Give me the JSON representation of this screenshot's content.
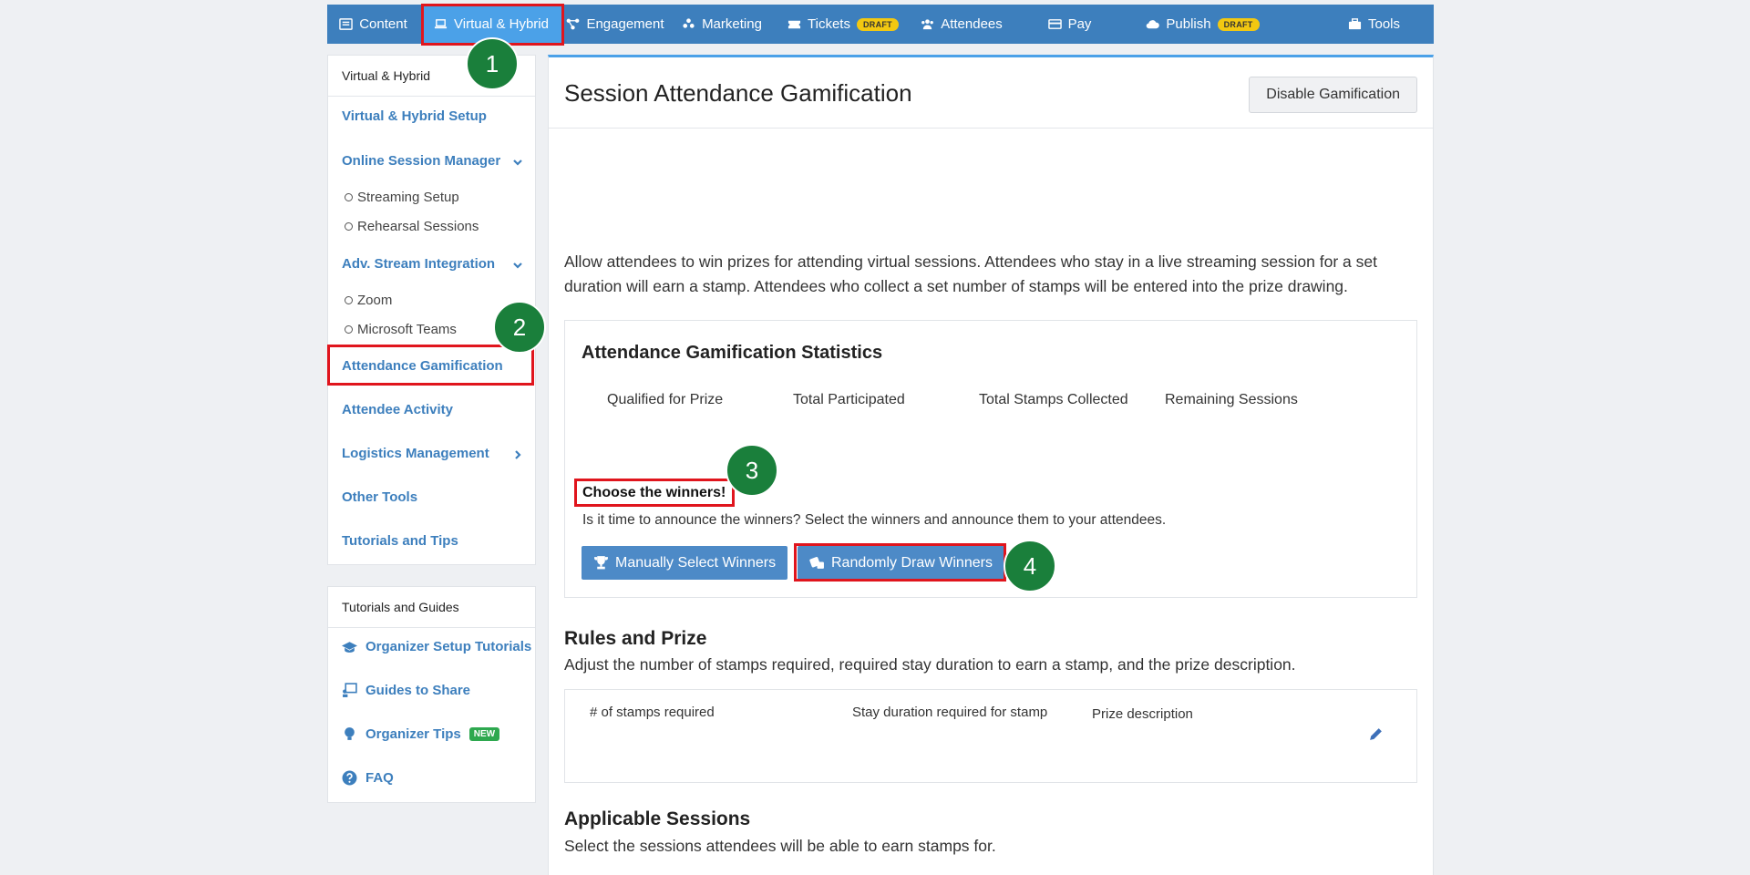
{
  "nav": {
    "items": [
      {
        "label": "Content",
        "icon": "newspaper-icon"
      },
      {
        "label": "Virtual & Hybrid",
        "icon": "laptop-icon"
      },
      {
        "label": "Engagement",
        "icon": "network-icon"
      },
      {
        "label": "Marketing",
        "icon": "people-icon"
      },
      {
        "label": "Tickets",
        "icon": "ticket-icon",
        "badge": "DRAFT"
      },
      {
        "label": "Attendees",
        "icon": "users-icon"
      },
      {
        "label": "Pay",
        "icon": "card-icon"
      },
      {
        "label": "Publish",
        "icon": "cloud-upload-icon",
        "badge": "DRAFT"
      },
      {
        "label": "Tools",
        "icon": "toolbox-icon"
      }
    ]
  },
  "sidebar": {
    "header": "Virtual & Hybrid",
    "items": {
      "setup": "Virtual & Hybrid Setup",
      "online_session_manager": "Online Session Manager",
      "streaming_setup": "Streaming Setup",
      "rehearsal_sessions": "Rehearsal Sessions",
      "adv_stream": "Adv. Stream Integration",
      "zoom": "Zoom",
      "teams": "Microsoft Teams",
      "attendance_gamification": "Attendance Gamification",
      "attendee_activity": "Attendee Activity",
      "logistics": "Logistics Management",
      "other_tools": "Other Tools",
      "tutorials": "Tutorials and Tips"
    }
  },
  "guides": {
    "header": "Tutorials and Guides",
    "organizer_setup": "Organizer Setup Tutorials",
    "guides_share": "Guides to Share",
    "organizer_tips": "Organizer Tips",
    "new_badge": "NEW",
    "faq": "FAQ"
  },
  "main": {
    "title": "Session Attendance Gamification",
    "disable_button": "Disable Gamification",
    "intro": "Allow attendees to win prizes for attending virtual sessions. Attendees who stay in a live streaming session for a set duration will earn a stamp. Attendees who collect a set number of stamps will be entered into the prize drawing.",
    "stats": {
      "title": "Attendance Gamification Statistics",
      "labels": [
        "Qualified for Prize",
        "Total Participated",
        "Total Stamps Collected",
        "Remaining Sessions"
      ]
    },
    "choose": {
      "title": "Choose the winners!",
      "desc": "Is it time to announce the winners? Select the winners and announce them to your attendees.",
      "manual_button": "Manually Select Winners",
      "random_button": "Randomly Draw Winners"
    },
    "rules": {
      "title": "Rules and Prize",
      "desc": "Adjust the number of stamps required, required stay duration to earn a stamp, and the prize description.",
      "columns": [
        "# of stamps required",
        "Stay duration required for stamp",
        "Prize description"
      ]
    },
    "sessions": {
      "title": "Applicable Sessions",
      "desc": "Select the sessions attendees will be able to earn stamps for."
    }
  },
  "annotations": [
    "1",
    "2",
    "3",
    "4"
  ],
  "colors": {
    "nav": "#3d7fbd",
    "nav_active": "#4ba1e8",
    "badge": "#1a7f3b",
    "highlight": "#e0151d",
    "button": "#4d8ac7"
  }
}
